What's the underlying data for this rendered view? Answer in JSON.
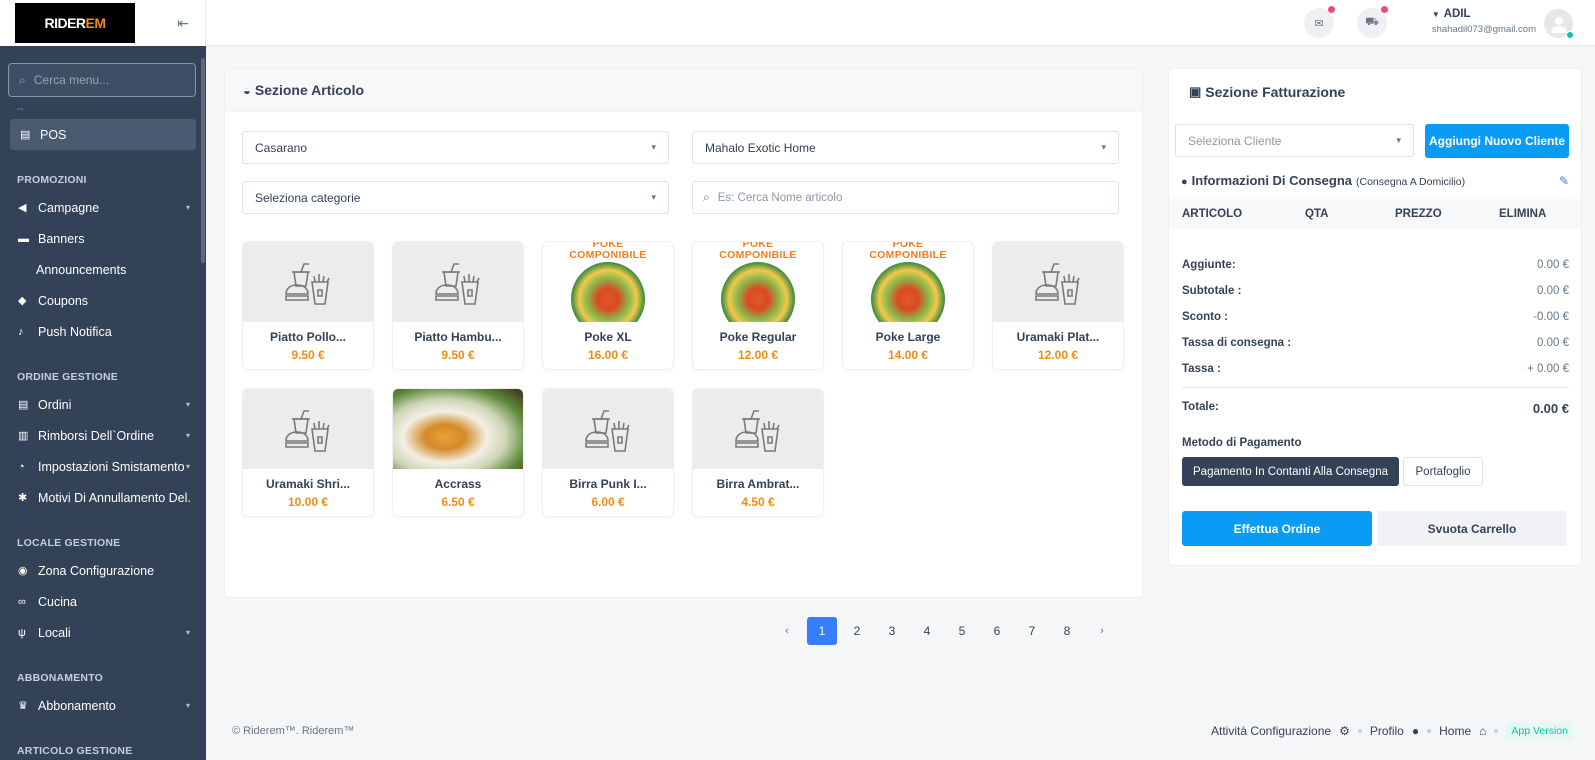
{
  "sidebar": {
    "logo_main": "RIDER",
    "logo_accent": "EM",
    "search_placeholder": "Cerca menu...",
    "dash": "--",
    "pos_label": "POS",
    "sections": {
      "promozioni": "PROMOZIONI",
      "ordine": "ORDINE GESTIONE",
      "locale": "LOCALE GESTIONE",
      "abbonamento": "ABBONAMENTO",
      "articolo": "ARTICOLO GESTIONE"
    },
    "items": {
      "campagne": "Campagne",
      "banners": "Banners",
      "announcements": "Announcements",
      "coupons": "Coupons",
      "push": "Push Notifica",
      "ordini": "Ordini",
      "rimborsi": "Rimborsi Dell`Ordine",
      "impostazioni": "Impostazioni Smistamento",
      "motivi": "Motivi Di Annullamento Del...",
      "zona": "Zona Configurazione",
      "cucina": "Cucina",
      "locali": "Locali",
      "abbonamento": "Abbonamento"
    }
  },
  "topbar": {
    "user_name": "ADIL",
    "user_email": "shahadil073@gmail.com"
  },
  "articolo": {
    "title": "Sezione Articolo",
    "select_city": "Casarano",
    "select_store": "Mahalo Exotic Home",
    "select_category": "Seleziona categorie",
    "search_placeholder": "Es: Cerca Nome articolo",
    "products": [
      {
        "name": "Piatto Pollo...",
        "price": "9.50 €",
        "img": "placeholder"
      },
      {
        "name": "Piatto Hambu...",
        "price": "9.50 €",
        "img": "placeholder"
      },
      {
        "name": "Poke XL",
        "price": "16.00 €",
        "img": "poke"
      },
      {
        "name": "Poke Regular",
        "price": "12.00 €",
        "img": "poke"
      },
      {
        "name": "Poke Large",
        "price": "14.00 €",
        "img": "poke"
      },
      {
        "name": "Uramaki Plat...",
        "price": "12.00 €",
        "img": "placeholder"
      },
      {
        "name": "Uramaki Shri...",
        "price": "10.00 €",
        "img": "placeholder"
      },
      {
        "name": "Accrass",
        "price": "6.50 €",
        "img": "food"
      },
      {
        "name": "Birra Punk I...",
        "price": "6.00 €",
        "img": "placeholder"
      },
      {
        "name": "Birra Ambrat...",
        "price": "4.50 €",
        "img": "placeholder"
      }
    ],
    "poke_line1": "POKE",
    "poke_line2": "COMPONIBILE",
    "pagination": {
      "prev": "‹",
      "pages": [
        "1",
        "2",
        "3",
        "4",
        "5",
        "6",
        "7",
        "8"
      ],
      "current": "1",
      "next": "›"
    }
  },
  "fatturazione": {
    "title": "Sezione Fatturazione",
    "select_client_placeholder": "Seleziona Cliente",
    "add_client": "Aggiungi Nuovo Cliente",
    "delivery_title": "Informazioni Di Consegna",
    "delivery_sub": "(Consegna A Domicilio)",
    "table_headers": [
      "ARTICOLO",
      "QTA",
      "PREZZO",
      "ELIMINA"
    ],
    "summary": [
      {
        "label": "Aggiunte:",
        "value": "0.00 €"
      },
      {
        "label": "Subtotale :",
        "value": "0.00 €"
      },
      {
        "label": "Sconto :",
        "value": "-0.00 €"
      },
      {
        "label": "Tassa di consegna :",
        "value": "0.00 €"
      },
      {
        "label": "Tassa :",
        "value": "+ 0.00 €"
      }
    ],
    "total_label": "Totale:",
    "total_value": "0.00 €",
    "payment_title": "Metodo di Pagamento",
    "pay_cash": "Pagamento In Contanti Alla Consegna",
    "pay_wallet": "Portafoglio",
    "place_order": "Effettua Ordine",
    "empty_cart": "Svuota Carrello"
  },
  "footer": {
    "copyright": "© Riderem™. Riderem™",
    "settings": "Attività Configurazione",
    "profile": "Profilo",
    "home": "Home",
    "app_version": "App Version"
  },
  "colors": {
    "sidebar": "#334257",
    "accent": "#0a9cf5",
    "price": "#f28b14",
    "page_active": "#377dff"
  }
}
